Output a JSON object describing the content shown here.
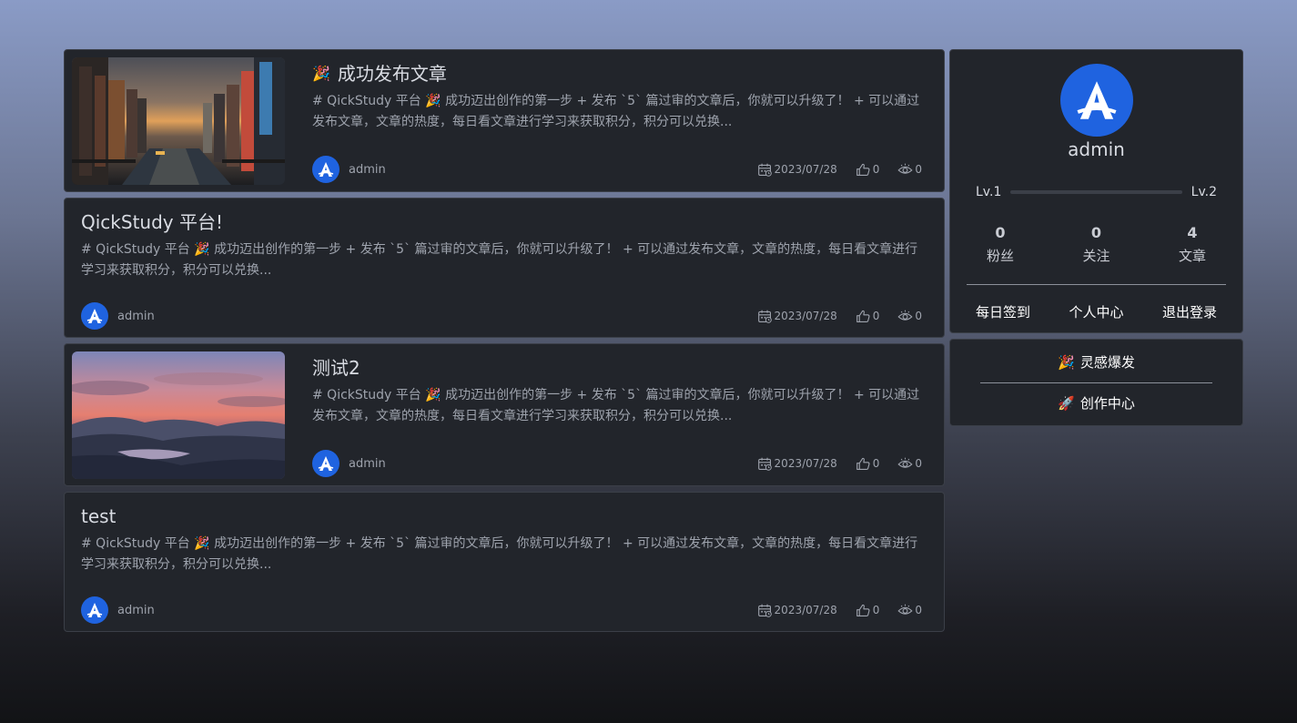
{
  "posts": [
    {
      "title": "成功发布文章",
      "title_emoji": "🎉",
      "has_image": true,
      "image_icon": "city-canal-photo",
      "excerpt": "# QickStudy 平台 🎉 成功迈出创作的第一步 + 发布 `5` 篇过审的文章后，你就可以升级了！ + 可以通过发布文章，文章的热度，每日看文章进行学习来获取积分，积分可以兑换...",
      "author": "admin",
      "date": "2023/07/28",
      "likes": "0",
      "views": "0"
    },
    {
      "title": "QickStudy 平台!",
      "title_emoji": "",
      "has_image": false,
      "excerpt": "# QickStudy 平台 🎉 成功迈出创作的第一步 + 发布 `5` 篇过审的文章后，你就可以升级了！ + 可以通过发布文章，文章的热度，每日看文章进行学习来获取积分，积分可以兑换...",
      "author": "admin",
      "date": "2023/07/28",
      "likes": "0",
      "views": "0"
    },
    {
      "title": "测试2",
      "title_emoji": "",
      "has_image": true,
      "image_icon": "sunset-landscape-photo",
      "excerpt": "# QickStudy 平台 🎉 成功迈出创作的第一步 + 发布 `5` 篇过审的文章后，你就可以升级了！ + 可以通过发布文章，文章的热度，每日看文章进行学习来获取积分，积分可以兑换...",
      "author": "admin",
      "date": "2023/07/28",
      "likes": "0",
      "views": "0"
    },
    {
      "title": "test",
      "title_emoji": "",
      "has_image": false,
      "excerpt": "# QickStudy 平台 🎉 成功迈出创作的第一步 + 发布 `5` 篇过审的文章后，你就可以升级了！ + 可以通过发布文章，文章的热度，每日看文章进行学习来获取积分，积分可以兑换...",
      "author": "admin",
      "date": "2023/07/28",
      "likes": "0",
      "views": "0"
    }
  ],
  "profile": {
    "name": "admin",
    "level_from": "Lv.1",
    "level_to": "Lv.2",
    "level_progress": 0,
    "followers_count": "0",
    "followers_label": "粉丝",
    "following_count": "0",
    "following_label": "关注",
    "articles_count": "4",
    "articles_label": "文章",
    "checkin_label": "每日签到",
    "center_label": "个人中心",
    "logout_label": "退出登录"
  },
  "shortcuts": {
    "inspiration_emoji": "🎉",
    "inspiration_label": "灵感爆发",
    "creation_emoji": "🚀",
    "creation_label": "创作中心"
  },
  "colors": {
    "accent": "#1f63e0",
    "card_bg": "#22252b",
    "text_muted": "#9ea3ad"
  }
}
